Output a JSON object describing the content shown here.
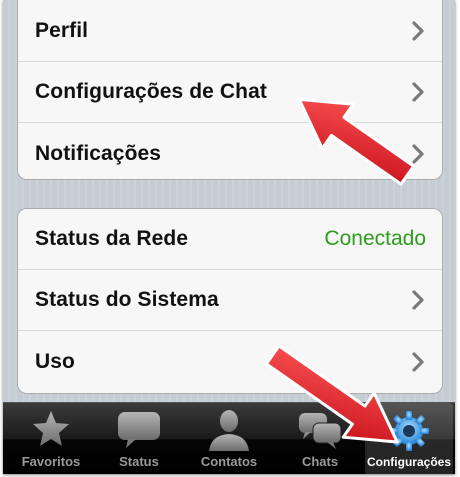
{
  "settings": {
    "group1": [
      {
        "label": "Perfil"
      },
      {
        "label": "Configurações de Chat"
      },
      {
        "label": "Notificações"
      }
    ],
    "group2": [
      {
        "label": "Status da Rede",
        "value": "Conectado"
      },
      {
        "label": "Status do Sistema"
      },
      {
        "label": "Uso"
      }
    ]
  },
  "tabbar": {
    "tabs": [
      {
        "label": "Favoritos",
        "icon": "star-icon"
      },
      {
        "label": "Status",
        "icon": "speech-bubble-icon"
      },
      {
        "label": "Contatos",
        "icon": "person-icon"
      },
      {
        "label": "Chats",
        "icon": "chat-bubbles-icon"
      },
      {
        "label": "Configurações",
        "icon": "gear-icon",
        "selected": true
      }
    ]
  },
  "colors": {
    "value_green": "#2e9d1d",
    "annotation_red": "#e8202a",
    "gear_blue": "#3a9ee8"
  }
}
